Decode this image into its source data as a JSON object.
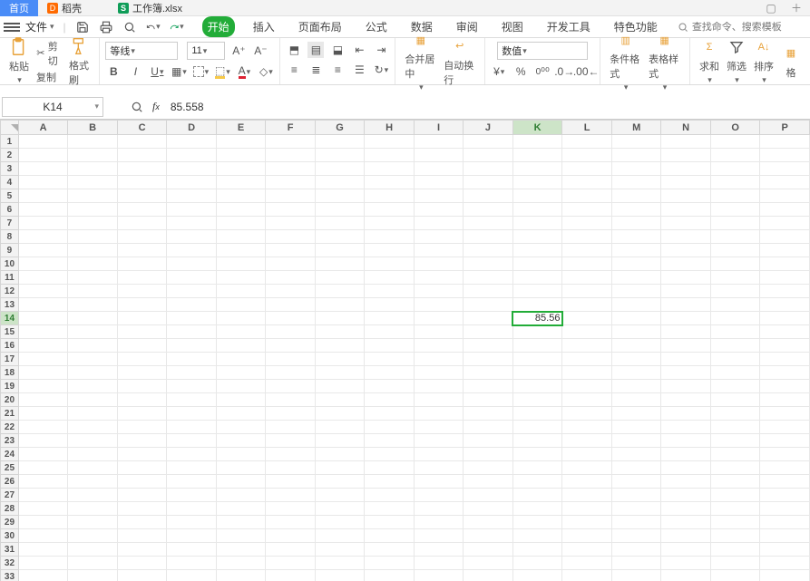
{
  "tabs": {
    "home": "首页",
    "daoke": "稻壳",
    "workbook": "工作簿.xlsx"
  },
  "menu": {
    "file": "文件"
  },
  "search": {
    "placeholder": "查找命令、搜索模板"
  },
  "ribbon_tabs": {
    "start": "开始",
    "insert": "插入",
    "page_layout": "页面布局",
    "formulas": "公式",
    "data": "数据",
    "review": "审阅",
    "view": "视图",
    "developer": "开发工具",
    "special": "特色功能"
  },
  "ribbon": {
    "paste": "粘贴",
    "cut": "剪切",
    "copy": "复制",
    "format_painter": "格式刷",
    "font_name": "等线",
    "font_size": "11",
    "merge_center": "合并居中",
    "wrap_text": "自动换行",
    "number_format": "数值",
    "cond_format": "条件格式",
    "table_style": "表格样式",
    "sum": "求和",
    "filter": "筛选",
    "sort": "排序",
    "format": "格"
  },
  "name_box": "K14",
  "formula_value": "85.558",
  "columns": [
    "A",
    "B",
    "C",
    "D",
    "E",
    "F",
    "G",
    "H",
    "I",
    "J",
    "K",
    "L",
    "M",
    "N",
    "O",
    "P"
  ],
  "row_count": 33,
  "selected": {
    "col": "K",
    "row": 14,
    "display": "85.56"
  }
}
